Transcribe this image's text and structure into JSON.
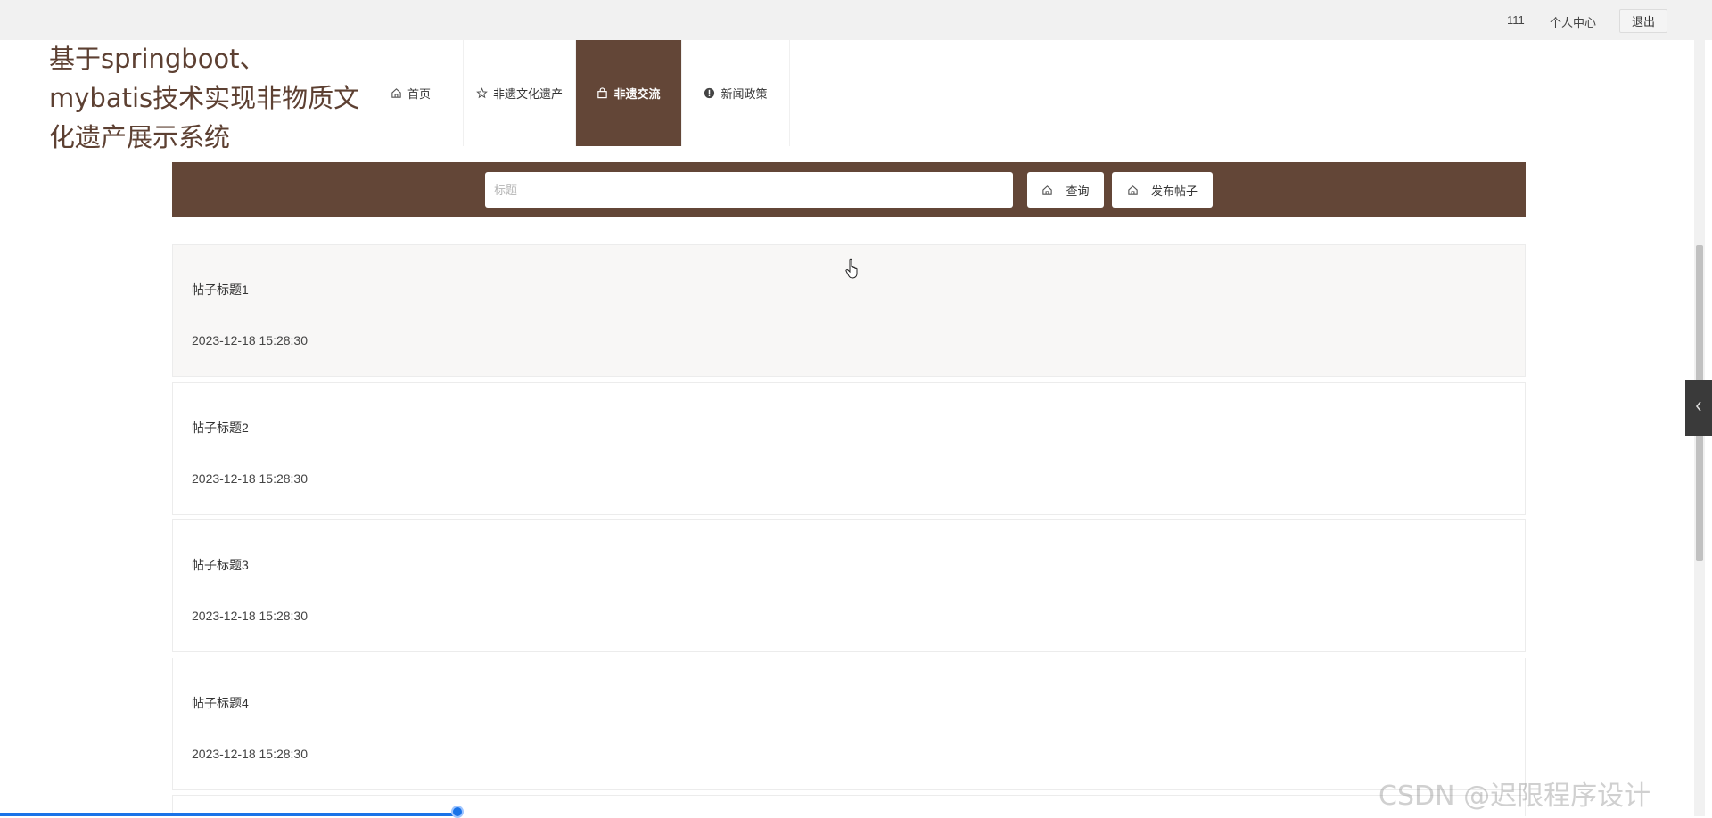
{
  "topbar": {
    "username": "111",
    "user_center": "个人中心",
    "logout": "退出"
  },
  "site": {
    "title": "基于springboot、mybatis技术实现非物质文化遗产展示系统"
  },
  "nav": {
    "items": [
      {
        "label": "首页",
        "icon": "home-icon",
        "active": false
      },
      {
        "label": "非遗文化遗产",
        "icon": "star-icon",
        "active": false
      },
      {
        "label": "非遗交流",
        "icon": "bag-icon",
        "active": true
      },
      {
        "label": "新闻政策",
        "icon": "alert-icon",
        "active": false
      }
    ]
  },
  "search": {
    "placeholder": "标题",
    "value": "",
    "query_label": "查询",
    "post_label": "发布帖子"
  },
  "posts": [
    {
      "title": "帖子标题1",
      "time": "2023-12-18 15:28:30"
    },
    {
      "title": "帖子标题2",
      "time": "2023-12-18 15:28:30"
    },
    {
      "title": "帖子标题3",
      "time": "2023-12-18 15:28:30"
    },
    {
      "title": "帖子标题4",
      "time": "2023-12-18 15:28:30"
    }
  ],
  "colors": {
    "brand": "#634637",
    "title_text": "#5d4032",
    "progress": "#1a73e8"
  },
  "video_progress": 0.267,
  "watermark": "CSDN @迟限程序设计"
}
